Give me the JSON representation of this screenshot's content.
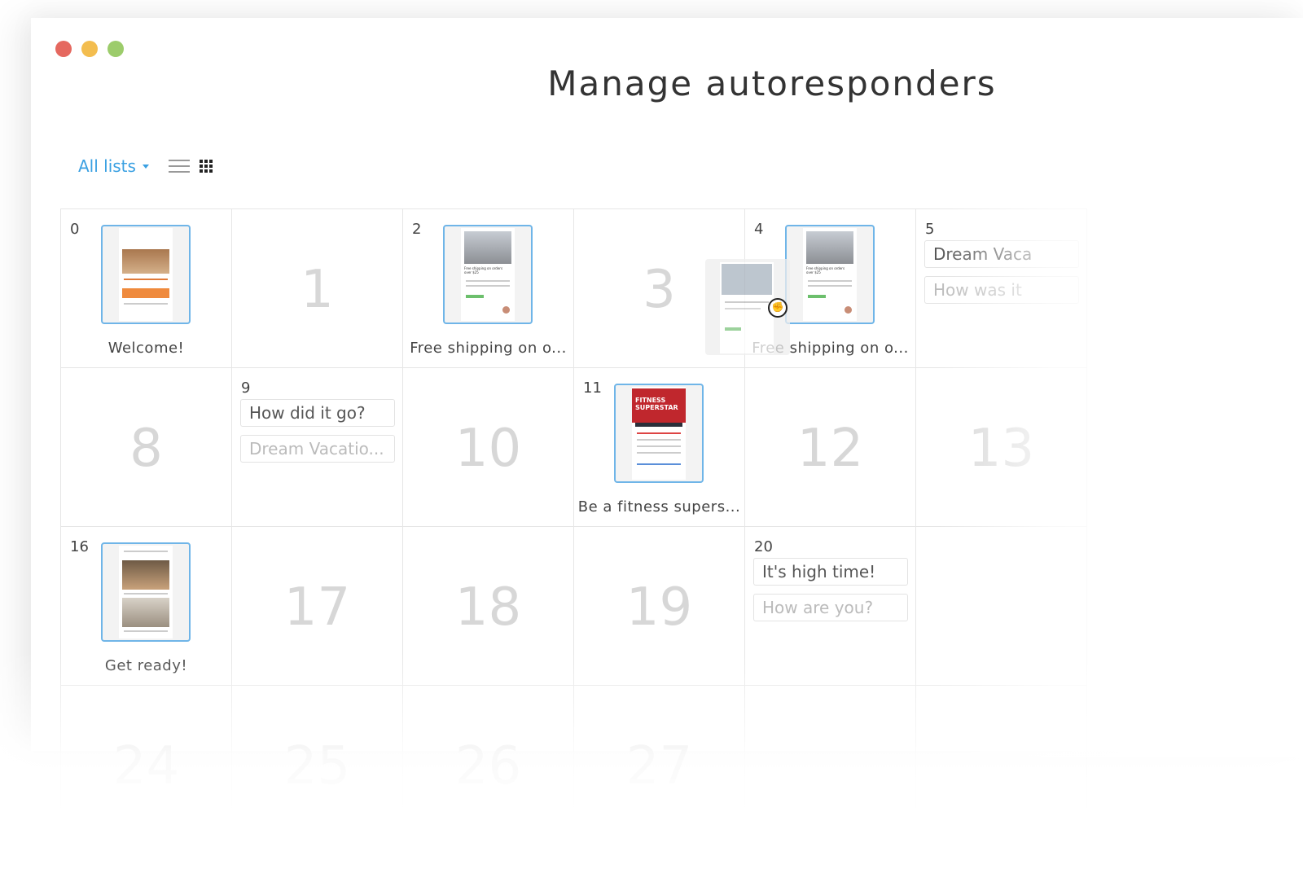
{
  "window": {
    "title": "Manage autoresponders",
    "traffic_lights": [
      "#e5685f",
      "#f3bd4f",
      "#9ccc6b"
    ]
  },
  "toolbar": {
    "list_filter_label": "All lists",
    "icons": [
      "list-view-icon",
      "grid-view-icon"
    ]
  },
  "calendar": {
    "rows": [
      [
        {
          "day": "0",
          "type": "message",
          "caption": "Welcome!"
        },
        {
          "day": "1",
          "type": "empty"
        },
        {
          "day": "2",
          "type": "message",
          "caption": "Free shipping on o..."
        },
        {
          "day": "3",
          "type": "empty"
        },
        {
          "day": "4",
          "type": "message",
          "caption": "Free shipping on o..."
        },
        {
          "day": "5",
          "type": "chips",
          "chips": [
            "Dream Vaca",
            "How was it"
          ]
        }
      ],
      [
        {
          "day": "8",
          "type": "empty"
        },
        {
          "day": "9",
          "type": "chips",
          "chips": [
            "How did it go?",
            "Dream Vacatio..."
          ]
        },
        {
          "day": "10",
          "type": "empty"
        },
        {
          "day": "11",
          "type": "message",
          "caption": "Be a fitness supers..."
        },
        {
          "day": "12",
          "type": "empty"
        },
        {
          "day": "13",
          "type": "empty"
        }
      ],
      [
        {
          "day": "16",
          "type": "message",
          "caption": "Get ready!"
        },
        {
          "day": "17",
          "type": "empty"
        },
        {
          "day": "18",
          "type": "empty"
        },
        {
          "day": "19",
          "type": "empty"
        },
        {
          "day": "20",
          "type": "chips",
          "chips": [
            "It's high time!",
            "How are you?"
          ]
        },
        {
          "day": "",
          "type": "empty"
        }
      ],
      [
        {
          "day": "24",
          "type": "empty"
        },
        {
          "day": "25",
          "type": "empty"
        },
        {
          "day": "26",
          "type": "empty"
        },
        {
          "day": "27",
          "type": "empty"
        },
        {
          "day": "",
          "type": "empty"
        },
        {
          "day": "",
          "type": "empty"
        }
      ]
    ],
    "thumb_text": {
      "fitness_heading": "FITNESS SUPERSTAR",
      "shipping_heading": "Free shipping on orders over $25"
    }
  },
  "colors": {
    "accent": "#3aa0e2",
    "thumb_border": "#6fb5e8",
    "big_number": "#d7d7d7"
  }
}
